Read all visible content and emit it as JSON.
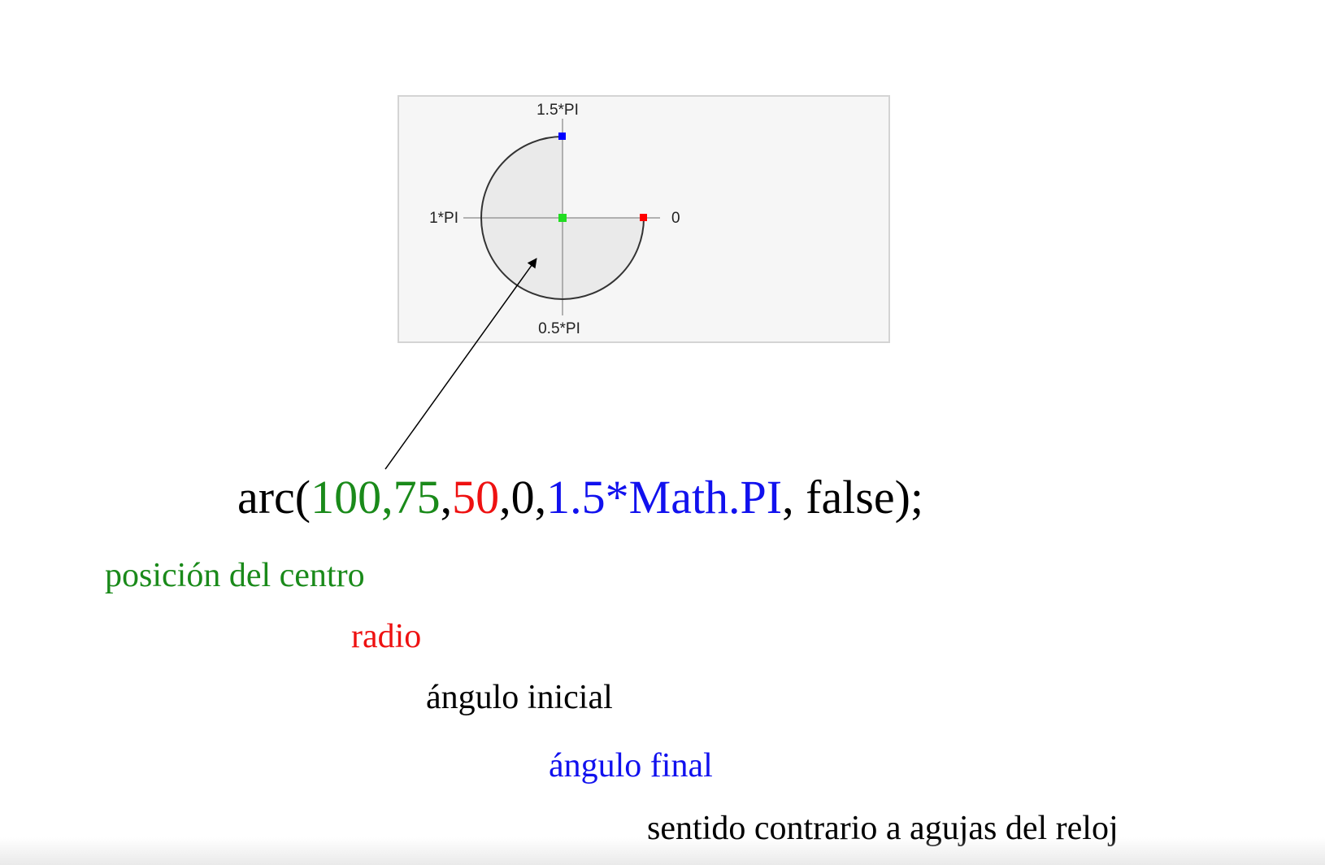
{
  "colors": {
    "green": "#1a8a1a",
    "red": "#ee1111",
    "blue": "#1111ee",
    "black": "#000000",
    "center_marker": "#22dd22",
    "start_marker": "#ff0000",
    "end_marker": "#0000ff",
    "panel_background": "#f6f6f6",
    "arc_fill": "#eaeaea"
  },
  "canvas_panel": {
    "label_top": "1.5*PI",
    "label_left": "1*PI",
    "label_right": "0",
    "label_bottom": "0.5*PI",
    "arc_start_angle_pi": 0,
    "arc_end_angle_pi": 1.5,
    "counterclockwise": false
  },
  "code": {
    "prefix": "arc(",
    "center_x": "100",
    "comma_1": ",",
    "center_y": "75",
    "comma_2": ",",
    "radius": "50",
    "comma_3": ",",
    "start_angle": "0",
    "comma_4": ",",
    "end_angle": "1.5*Math.PI",
    "suffix": ", false);"
  },
  "captions": {
    "center": "posición del centro",
    "radius": "radio",
    "start_angle": "ángulo inicial",
    "end_angle": "ángulo final",
    "direction": "sentido contrario a agujas del reloj"
  }
}
